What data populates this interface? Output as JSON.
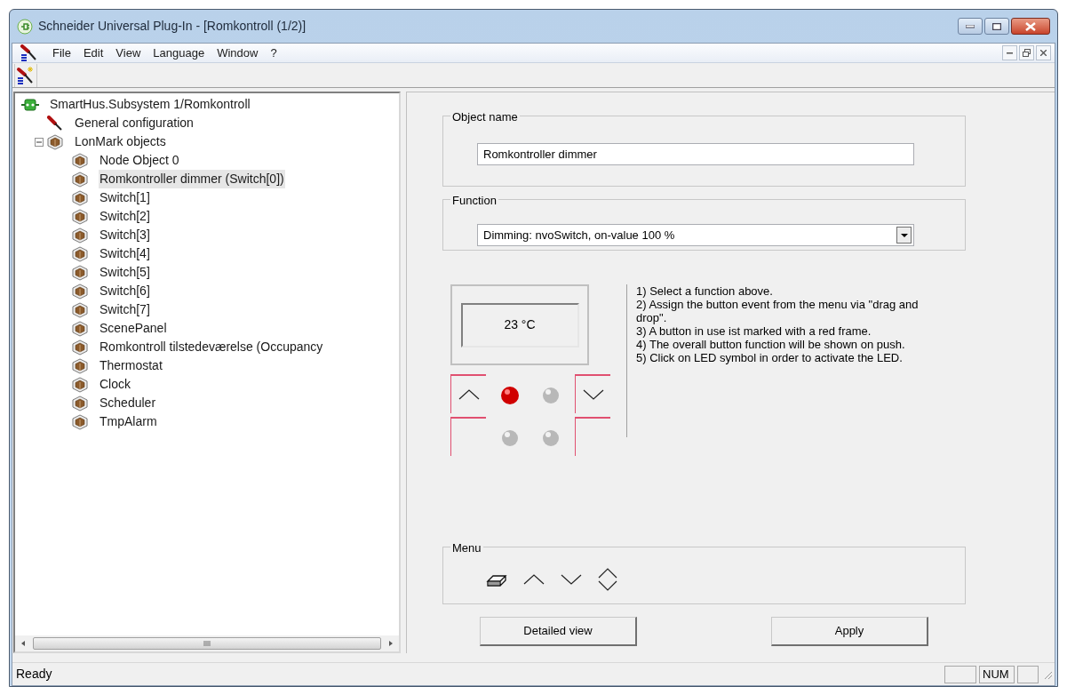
{
  "window": {
    "title": "Schneider Universal Plug-In - [Romkontroll (1/2)]"
  },
  "menu": [
    {
      "label": "File"
    },
    {
      "label": "Edit"
    },
    {
      "label": "View"
    },
    {
      "label": "Language"
    },
    {
      "label": "Window"
    },
    {
      "label": "?"
    }
  ],
  "tree": {
    "items": [
      {
        "label": "SmartHus.Subsystem 1/Romkontroll",
        "kind": "root",
        "selected": false,
        "children": [
          {
            "label": "General configuration",
            "kind": "config",
            "selected": false
          },
          {
            "label": "LonMark objects",
            "kind": "object",
            "selected": false,
            "expanded": true,
            "children": [
              {
                "label": "Node Object 0",
                "kind": "object",
                "selected": false
              },
              {
                "label": "Romkontroller dimmer (Switch[0])",
                "kind": "object",
                "selected": true
              },
              {
                "label": "Switch[1]",
                "kind": "object",
                "selected": false
              },
              {
                "label": "Switch[2]",
                "kind": "object",
                "selected": false
              },
              {
                "label": "Switch[3]",
                "kind": "object",
                "selected": false
              },
              {
                "label": "Switch[4]",
                "kind": "object",
                "selected": false
              },
              {
                "label": "Switch[5]",
                "kind": "object",
                "selected": false
              },
              {
                "label": "Switch[6]",
                "kind": "object",
                "selected": false
              },
              {
                "label": "Switch[7]",
                "kind": "object",
                "selected": false
              },
              {
                "label": "ScenePanel",
                "kind": "object",
                "selected": false
              },
              {
                "label": "Romkontroll tilstedeværelse (Occupancy",
                "kind": "object",
                "selected": false
              },
              {
                "label": "Thermostat",
                "kind": "object",
                "selected": false
              },
              {
                "label": "Clock",
                "kind": "object",
                "selected": false
              },
              {
                "label": "Scheduler",
                "kind": "object",
                "selected": false
              },
              {
                "label": "TmpAlarm",
                "kind": "object",
                "selected": false
              }
            ]
          }
        ]
      }
    ]
  },
  "object_name": {
    "label": "Object name",
    "value": "Romkontroller dimmer"
  },
  "function": {
    "label": "Function",
    "value": "Dimming: nvoSwitch, on-value 100 %"
  },
  "panel": {
    "display": "23 °C",
    "buttons": [
      {
        "kind": "up",
        "in_use": true
      },
      {
        "kind": "down",
        "in_use": true
      },
      {
        "kind": "blank",
        "in_use": true
      },
      {
        "kind": "blank",
        "in_use": true
      }
    ],
    "leds": [
      {
        "on": true
      },
      {
        "on": false
      },
      {
        "on": false
      },
      {
        "on": false
      }
    ]
  },
  "instructions": [
    "1) Select a function above.",
    "2) Assign the button event from the menu via \"drag and drop\".",
    "3) A button in use ist marked with a red frame.",
    "4) The overall button function will be shown on push.",
    "5) Click on LED symbol in order to activate the LED."
  ],
  "menu_group": {
    "label": "Menu"
  },
  "buttons": [
    {
      "label": "Detailed view"
    },
    {
      "label": "Apply"
    }
  ],
  "status_bar": {
    "text": "Ready",
    "panels": [
      {
        "label": "NUM"
      }
    ]
  }
}
